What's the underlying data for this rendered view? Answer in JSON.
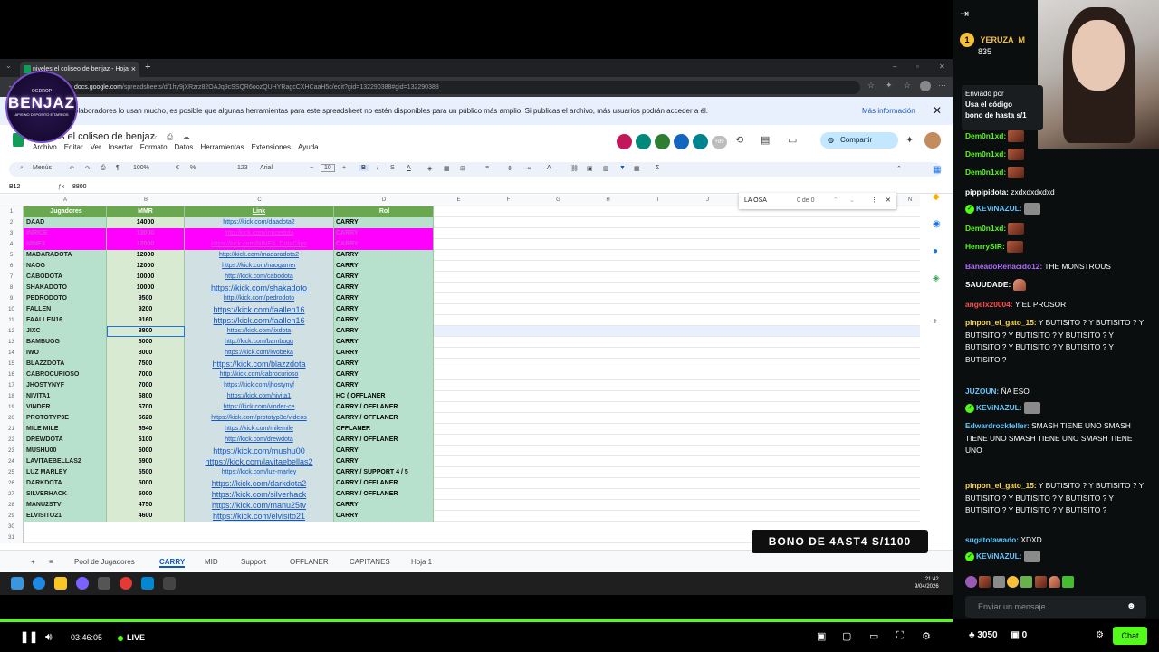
{
  "browser": {
    "tab_title": "niveles el coliseo de benjaz - Hoja",
    "url_host": "docs.google.com",
    "url_path": "/spreadsheets/d/1hy9jXRzrz82OAJq9cSSQR6oozQUHYRagcCXHCaaH5c/edit?gid=132290388#gid=132290388"
  },
  "overlay_logo": {
    "small": "OGDROP",
    "brand": "BENJAZ",
    "tag": "APIS NO DEPOSITO E TARROS"
  },
  "banner": {
    "message": "colaboradores lo usan mucho, es posible que algunas herramientas para este spreadsheet no estén disponibles para un público más amplio. Si publicas el archivo, más usuarios podrán acceder a él.",
    "more": "Más información"
  },
  "doc": {
    "title": "players el coliseo de benjaz",
    "menu": [
      "Archivo",
      "Editar",
      "Ver",
      "Insertar",
      "Formato",
      "Datos",
      "Herramientas",
      "Extensiones",
      "Ayuda"
    ],
    "collab_count": "+89",
    "share": "Compartir"
  },
  "toolbar": {
    "menus": "Menús",
    "zoom": "100%",
    "currency": "€",
    "percent": "%",
    "font": "Arial",
    "font_size": "10",
    "num_format": "123"
  },
  "formula": {
    "cell_ref": "B12",
    "value": "8800"
  },
  "find": {
    "query": "LA OSA",
    "count": "0 de 0"
  },
  "columns": [
    "A",
    "B",
    "C",
    "D",
    "E",
    "F",
    "G",
    "H",
    "I",
    "J",
    "K",
    "N"
  ],
  "sheet": {
    "headers": [
      "Jugadores",
      "MMR",
      "Link",
      "Rol"
    ],
    "rows": [
      {
        "n": "2",
        "player": "DAAD",
        "mmr": "14000",
        "link": "https://kick.com/daadota2",
        "role": "CARRY",
        "style": "green",
        "big": false
      },
      {
        "n": "3",
        "player": "INRICE",
        "mmr": "13000",
        "link": "http://kick.com/inricedota",
        "role": "CARRY",
        "style": "pink",
        "big": false
      },
      {
        "n": "4",
        "player": "NINEX",
        "mmr": "12000",
        "link": "https://kick.com/NINEX_DotaClips",
        "role": "CARRY",
        "style": "pink",
        "big": false
      },
      {
        "n": "5",
        "player": "MADARADOTA",
        "mmr": "12000",
        "link": "http://kick.com/madaradota2",
        "role": "CARRY",
        "style": "green",
        "big": false
      },
      {
        "n": "6",
        "player": "NAOG",
        "mmr": "12000",
        "link": "https://kick.com/naogamer",
        "role": "CARRY",
        "style": "green",
        "big": false
      },
      {
        "n": "7",
        "player": "CABODOTA",
        "mmr": "10000",
        "link": "http://kick.com/cabodota",
        "role": "CARRY",
        "style": "green",
        "big": false
      },
      {
        "n": "8",
        "player": "SHAKADOTO",
        "mmr": "10000",
        "link": "https://kick.com/shakadoto",
        "role": "CARRY",
        "style": "green",
        "big": true
      },
      {
        "n": "9",
        "player": "PEDRODOTO",
        "mmr": "9500",
        "link": "http://kick.com/pedrodoto",
        "role": "CARRY",
        "style": "green",
        "big": false
      },
      {
        "n": "10",
        "player": "FALLEN",
        "mmr": "9200",
        "link": "https://kick.com/faallen16",
        "role": "CARRY",
        "style": "green",
        "big": true
      },
      {
        "n": "11",
        "player": "FAALLEN16",
        "mmr": "9160",
        "link": "https://kick.com/faallen16",
        "role": "CARRY",
        "style": "green",
        "big": true
      },
      {
        "n": "12",
        "player": "JIXC",
        "mmr": "8800",
        "link": "https://kick.com/jixdota",
        "role": "CARRY",
        "style": "green",
        "big": false
      },
      {
        "n": "13",
        "player": "BAMBUGG",
        "mmr": "8000",
        "link": "http://kick.com/bambugg",
        "role": "CARRY",
        "style": "green",
        "big": false
      },
      {
        "n": "14",
        "player": "IWO",
        "mmr": "8000",
        "link": "https://kick.com/iwobeka",
        "role": "CARRY",
        "style": "green",
        "big": false
      },
      {
        "n": "15",
        "player": "BLAZZDOTA",
        "mmr": "7500",
        "link": "https://kick.com/blazzdota",
        "role": "CARRY",
        "style": "green",
        "big": true
      },
      {
        "n": "16",
        "player": "CABROCURIOSO",
        "mmr": "7000",
        "link": "http://kick.com/cabrocurioso",
        "role": "CARRY",
        "style": "green",
        "big": false
      },
      {
        "n": "17",
        "player": "JHOSTYNYF",
        "mmr": "7000",
        "link": "https://kick.com/jhostynyf",
        "role": "CARRY",
        "style": "green",
        "big": false
      },
      {
        "n": "18",
        "player": "NIVITA1",
        "mmr": "6800",
        "link": "https://kick.com/nivita1",
        "role": "HC ( OFFLANER",
        "style": "green",
        "big": false
      },
      {
        "n": "19",
        "player": "VINDER",
        "mmr": "6700",
        "link": "https://kick.com/vinder-ce",
        "role": "CARRY / OFFLANER",
        "style": "green",
        "big": false
      },
      {
        "n": "20",
        "player": "PROTOTYP3E",
        "mmr": "6620",
        "link": "https://kick.com/prototyp3e/videos",
        "role": "CARRY / OFFLANER",
        "style": "green",
        "big": false
      },
      {
        "n": "21",
        "player": "MILE MILE",
        "mmr": "6540",
        "link": "https://kick.com/milemile",
        "role": "OFFLANER",
        "style": "green",
        "big": false
      },
      {
        "n": "22",
        "player": "DREWDOTA",
        "mmr": "6100",
        "link": "http://kick.com/drewdota",
        "role": "CARRY / OFFLANER",
        "style": "green",
        "big": false
      },
      {
        "n": "23",
        "player": "MUSHU00",
        "mmr": "6000",
        "link": "https://kick.com/mushu00",
        "role": "CARRY",
        "style": "green",
        "big": true
      },
      {
        "n": "24",
        "player": "LAVITAEBELLAS2",
        "mmr": "5900",
        "link": "https://kick.com/lavitaebellas2",
        "role": "CARRY",
        "style": "green",
        "big": true
      },
      {
        "n": "25",
        "player": "LUZ MARLEY",
        "mmr": "5500",
        "link": "https://kick.com/luz-marley",
        "role": "CARRY / SUPPORT 4 / 5",
        "style": "green",
        "big": false
      },
      {
        "n": "26",
        "player": "DARKDOTA",
        "mmr": "5000",
        "link": "https://kick.com/darkdota2",
        "role": "CARRY / OFFLANER",
        "style": "green",
        "big": true
      },
      {
        "n": "27",
        "player": "SILVERHACK",
        "mmr": "5000",
        "link": "https://kick.com/silverhack",
        "role": "CARRY / OFFLANER",
        "style": "green",
        "big": true
      },
      {
        "n": "28",
        "player": "MANU2STV",
        "mmr": "4750",
        "link": "https://kick.com/manu25tv",
        "role": "CARRY",
        "style": "green",
        "big": true
      },
      {
        "n": "29",
        "player": "ELVISITO21",
        "mmr": "4600",
        "link": "https://kick.com/elvisito21",
        "role": "CARRY",
        "style": "green",
        "big": true
      }
    ],
    "empty_rows": [
      "30",
      "31"
    ]
  },
  "sheet_tabs": [
    "Pool de Jugadores",
    "CARRY",
    "MID",
    "Support",
    "OFFLANER",
    "CAPITANES",
    "Hoja 1"
  ],
  "active_tab": "CARRY",
  "promo": "BONO DE 4AST4 S/1100",
  "clock": {
    "time": "21:42",
    "date": "9/04/2026"
  },
  "chat": {
    "pinned_user": "YERUZA_M",
    "pinned_count": "835",
    "sent_by": "Enviado por",
    "pinned_msg_1": "Usa el código",
    "pinned_msg_2": "bono de hasta s/1",
    "messages": [
      {
        "user": "Dem0n1xd:",
        "color": "#53fc18",
        "text": "",
        "emo": "red"
      },
      {
        "user": "Dem0n1xd:",
        "color": "#53fc18",
        "text": "",
        "emo": "red"
      },
      {
        "user": "Dem0n1xd:",
        "color": "#53fc18",
        "text": "",
        "emo": "red"
      },
      {
        "user": "pippipidota:",
        "color": "#ffffff",
        "text": "zxdxdxdxdxd",
        "emo": ""
      },
      {
        "user": "KEViNAZUL:",
        "color": "#5ec8ff",
        "text": "",
        "emo": "grey"
      },
      {
        "user": "Dem0n1xd:",
        "color": "#53fc18",
        "text": "",
        "emo": "red"
      },
      {
        "user": "HenrrySIR:",
        "color": "#53fc18",
        "text": "",
        "emo": "red"
      },
      {
        "user": "BaneadoRenacido12:",
        "color": "#b06bff",
        "text": "THE MONSTROUS",
        "emo": ""
      },
      {
        "user": "SAUUDADE:",
        "color": "#ffffff",
        "text": "",
        "emo": "hand"
      },
      {
        "user": "angelx20004:",
        "color": "#ff4d4d",
        "text": "Y EL PROSOR",
        "emo": ""
      },
      {
        "user": "pinpon_el_gato_15:",
        "color": "#ffd84d",
        "text": "Y BUTISITO ? Y BUTISITO ? Y BUTISITO ? Y BUTISITO ? Y BUTISITO ? Y BUTISITO ? Y BUTISITO ? Y BUTISITO ? Y BUTISITO ?",
        "emo": ""
      },
      {
        "user": "JUZOUN:",
        "color": "#5ec8ff",
        "text": "ÑA ESO",
        "emo": ""
      },
      {
        "user": "KEViNAZUL:",
        "color": "#5ec8ff",
        "text": "",
        "emo": "grey"
      },
      {
        "user": "Edwardrockfeller:",
        "color": "#5ec8ff",
        "text": "SMASH TIENE UNO SMASH TIENE UNO SMASH TIENE UNO SMASH TIENE UNO",
        "emo": ""
      },
      {
        "user": "pinpon_el_gato_15:",
        "color": "#ffd84d",
        "text": "Y BUTISITO ? Y BUTISITO ? Y BUTISITO ? Y BUTISITO ? Y BUTISITO ? Y BUTISITO ? Y BUTISITO ? Y BUTISITO ?",
        "emo": ""
      },
      {
        "user": "sugatotawado:",
        "color": "#5ec8ff",
        "text": "XDXD",
        "emo": ""
      },
      {
        "user": "KEViNAZUL:",
        "color": "#5ec8ff",
        "text": "",
        "emo": "grey"
      }
    ],
    "input_placeholder": "Enviar un mensaje",
    "points": "3050",
    "viewers_small": "0",
    "chat_button": "Chat"
  },
  "player": {
    "time": "03:46:05",
    "live": "LIVE"
  },
  "colors": {
    "accent": "#53fc18",
    "header_green": "#6aa84f",
    "row_green": "#b7e1cd",
    "pink": "#ff00ff"
  }
}
